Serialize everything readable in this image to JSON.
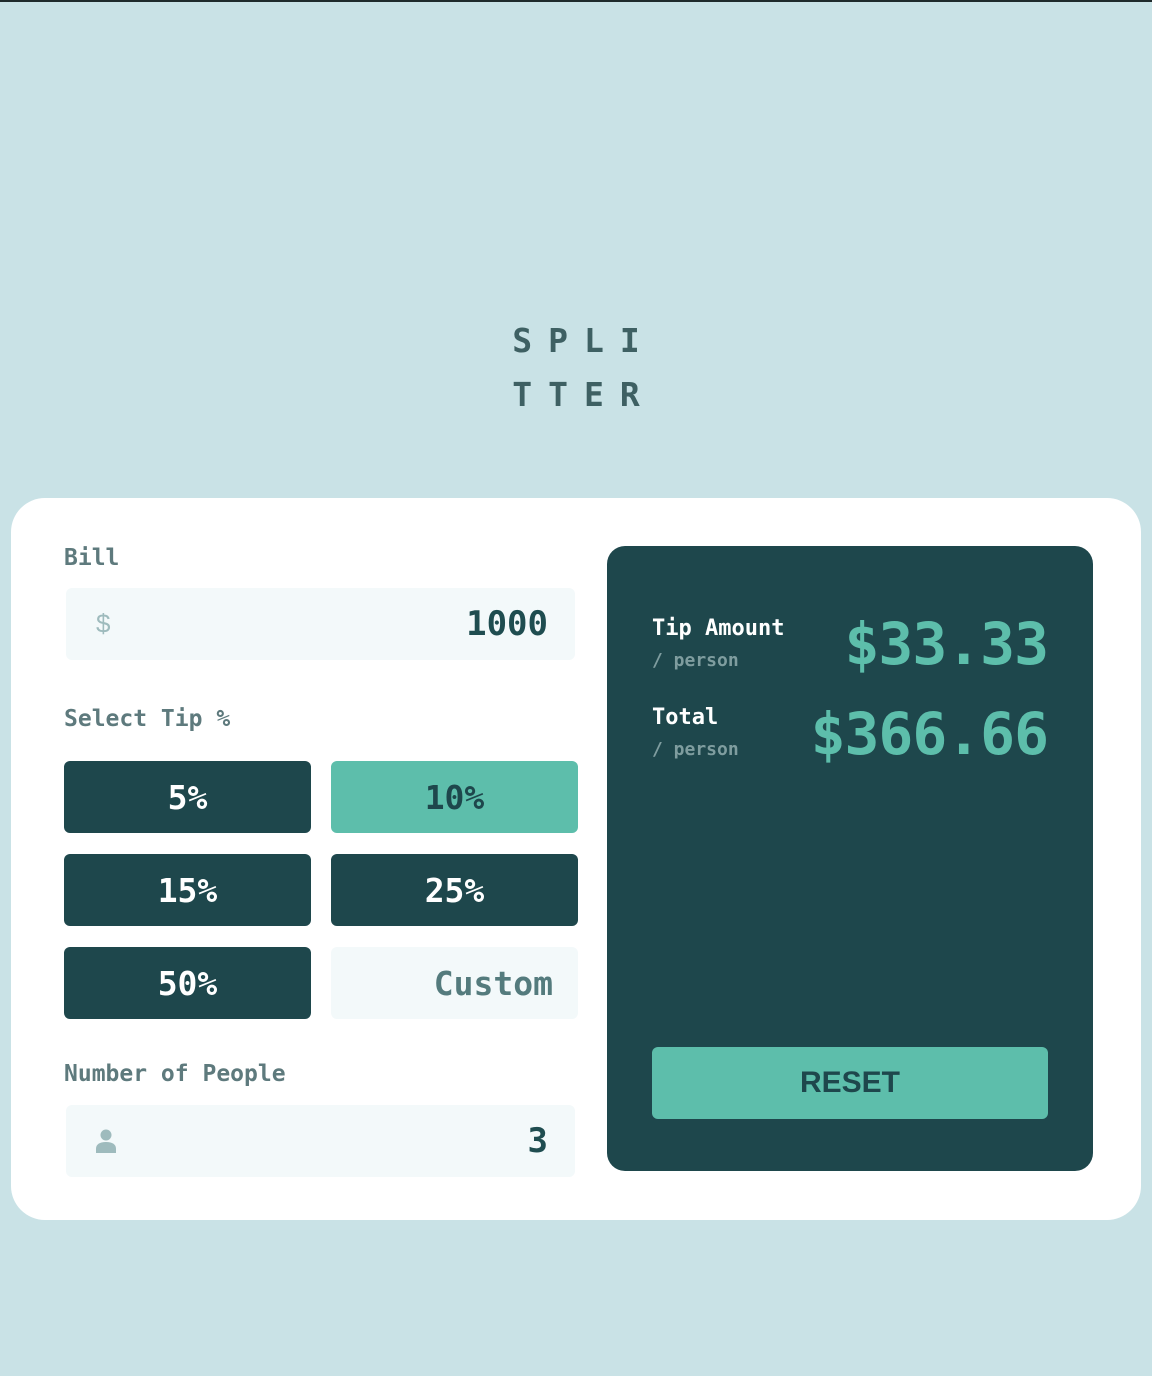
{
  "logo": {
    "line1": "SPLI",
    "line2": "TTER"
  },
  "bill": {
    "label": "Bill",
    "currency_icon": "$",
    "value": "1000"
  },
  "tip": {
    "label": "Select Tip %",
    "options": [
      "5%",
      "10%",
      "15%",
      "25%",
      "50%"
    ],
    "selected": "10%",
    "custom_placeholder": "Custom"
  },
  "people": {
    "label": "Number of People",
    "icon": "person-icon",
    "value": "3"
  },
  "result": {
    "tip_title": "Tip Amount",
    "tip_sub": "/ person",
    "tip_value": "$33.33",
    "total_title": "Total",
    "total_sub": "/ person",
    "total_value": "$366.66",
    "reset_label": "RESET"
  },
  "colors": {
    "background": "#c9e2e6",
    "dark_teal": "#1e474c",
    "accent": "#5dbeab",
    "input_bg": "#f3f9fa"
  }
}
